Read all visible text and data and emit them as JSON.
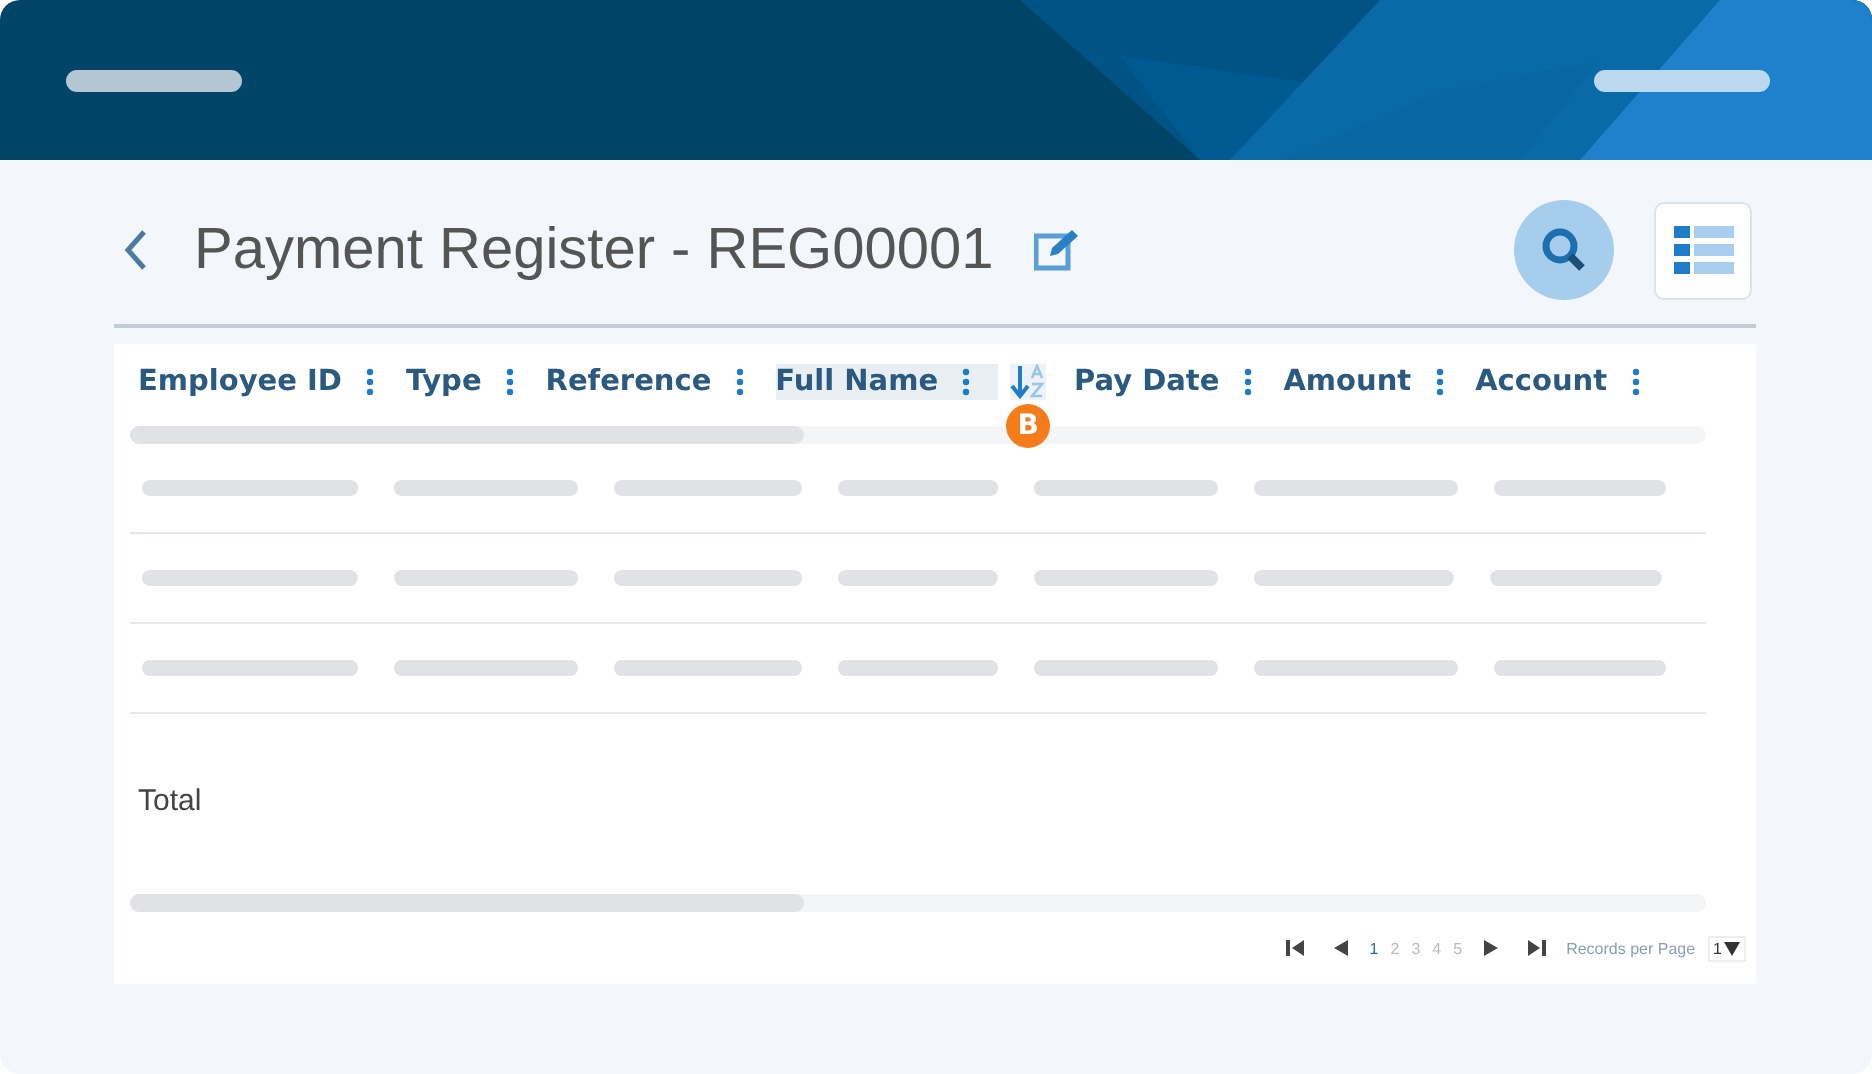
{
  "title": "Payment Register - REG00001",
  "columns": [
    {
      "label": "Employee ID",
      "sorted": false
    },
    {
      "label": "Type",
      "sorted": false
    },
    {
      "label": "Reference",
      "sorted": false
    },
    {
      "label": "Full Name",
      "sorted": true
    },
    {
      "label": "Pay Date",
      "sorted": false
    },
    {
      "label": "Amount",
      "sorted": false
    },
    {
      "label": "Account",
      "sorted": false
    }
  ],
  "sort_badge": "B",
  "rows": [
    {
      "kind": "placeholder"
    },
    {
      "kind": "placeholder"
    },
    {
      "kind": "placeholder"
    }
  ],
  "total_label": "Total",
  "pagination": {
    "pages": [
      {
        "label": "1",
        "selected": true
      },
      {
        "label": "2",
        "selected": false
      },
      {
        "label": "3",
        "selected": false
      },
      {
        "label": "4",
        "selected": false
      },
      {
        "label": "5",
        "selected": false
      }
    ],
    "records_label": "Records per Page",
    "page_size": "1"
  }
}
